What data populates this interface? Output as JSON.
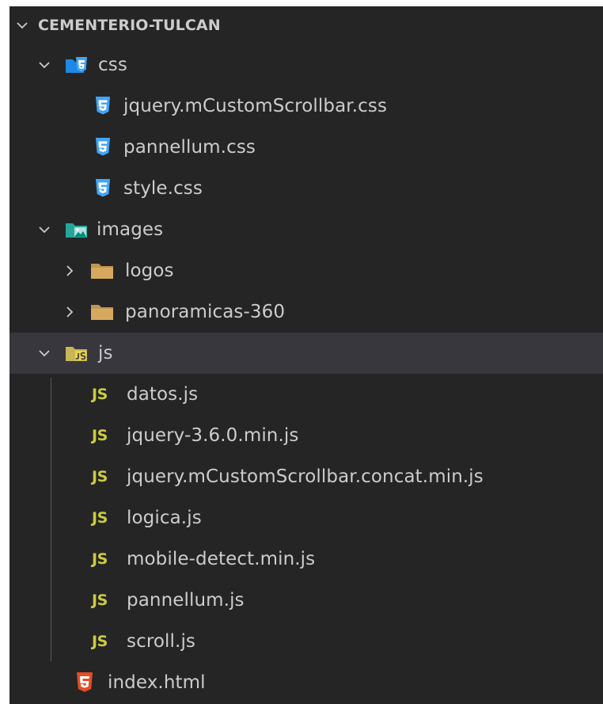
{
  "explorer": {
    "root": {
      "label": "CEMENTERIO-TULCAN",
      "expanded": true
    },
    "items": [
      {
        "label": "css",
        "kind": "folder",
        "icon": "css-folder-icon",
        "expanded": true
      },
      {
        "label": "jquery.mCustomScrollbar.css",
        "kind": "css-file",
        "icon": "css-file-icon"
      },
      {
        "label": "pannellum.css",
        "kind": "css-file",
        "icon": "css-file-icon"
      },
      {
        "label": "style.css",
        "kind": "css-file",
        "icon": "css-file-icon"
      },
      {
        "label": "images",
        "kind": "folder",
        "icon": "images-folder-icon",
        "expanded": true
      },
      {
        "label": "logos",
        "kind": "folder",
        "icon": "folder-icon",
        "expanded": false
      },
      {
        "label": "panoramicas-360",
        "kind": "folder",
        "icon": "folder-icon",
        "expanded": false
      },
      {
        "label": "js",
        "kind": "folder",
        "icon": "js-folder-icon",
        "expanded": true,
        "selected": true
      },
      {
        "label": "datos.js",
        "kind": "js-file",
        "icon": "js-file-icon"
      },
      {
        "label": "jquery-3.6.0.min.js",
        "kind": "js-file",
        "icon": "js-file-icon"
      },
      {
        "label": "jquery.mCustomScrollbar.concat.min.js",
        "kind": "js-file",
        "icon": "js-file-icon"
      },
      {
        "label": "logica.js",
        "kind": "js-file",
        "icon": "js-file-icon"
      },
      {
        "label": "mobile-detect.min.js",
        "kind": "js-file",
        "icon": "js-file-icon"
      },
      {
        "label": "pannellum.js",
        "kind": "js-file",
        "icon": "js-file-icon"
      },
      {
        "label": "scroll.js",
        "kind": "js-file",
        "icon": "js-file-icon"
      },
      {
        "label": "index.html",
        "kind": "html-file",
        "icon": "html-file-icon"
      }
    ],
    "js_badge": "JS",
    "colors": {
      "background": "#252526",
      "text": "#cccccc",
      "selected_row": "#37373d",
      "css_icon": "#42a5f5",
      "js_icon": "#cbcb41",
      "html_icon": "#e44d26",
      "folder": "#c09553",
      "images_folder": "#26a69a"
    }
  }
}
